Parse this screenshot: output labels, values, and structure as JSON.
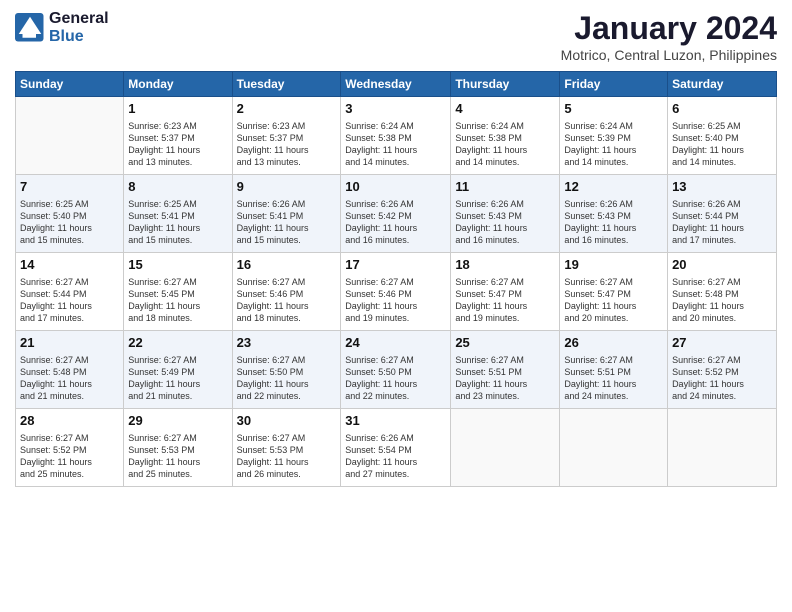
{
  "header": {
    "logo_line1": "General",
    "logo_line2": "Blue",
    "month_title": "January 2024",
    "location": "Motrico, Central Luzon, Philippines"
  },
  "weekdays": [
    "Sunday",
    "Monday",
    "Tuesday",
    "Wednesday",
    "Thursday",
    "Friday",
    "Saturday"
  ],
  "weeks": [
    [
      {
        "day": "",
        "info": ""
      },
      {
        "day": "1",
        "info": "Sunrise: 6:23 AM\nSunset: 5:37 PM\nDaylight: 11 hours\nand 13 minutes."
      },
      {
        "day": "2",
        "info": "Sunrise: 6:23 AM\nSunset: 5:37 PM\nDaylight: 11 hours\nand 13 minutes."
      },
      {
        "day": "3",
        "info": "Sunrise: 6:24 AM\nSunset: 5:38 PM\nDaylight: 11 hours\nand 14 minutes."
      },
      {
        "day": "4",
        "info": "Sunrise: 6:24 AM\nSunset: 5:38 PM\nDaylight: 11 hours\nand 14 minutes."
      },
      {
        "day": "5",
        "info": "Sunrise: 6:24 AM\nSunset: 5:39 PM\nDaylight: 11 hours\nand 14 minutes."
      },
      {
        "day": "6",
        "info": "Sunrise: 6:25 AM\nSunset: 5:40 PM\nDaylight: 11 hours\nand 14 minutes."
      }
    ],
    [
      {
        "day": "7",
        "info": "Sunrise: 6:25 AM\nSunset: 5:40 PM\nDaylight: 11 hours\nand 15 minutes."
      },
      {
        "day": "8",
        "info": "Sunrise: 6:25 AM\nSunset: 5:41 PM\nDaylight: 11 hours\nand 15 minutes."
      },
      {
        "day": "9",
        "info": "Sunrise: 6:26 AM\nSunset: 5:41 PM\nDaylight: 11 hours\nand 15 minutes."
      },
      {
        "day": "10",
        "info": "Sunrise: 6:26 AM\nSunset: 5:42 PM\nDaylight: 11 hours\nand 16 minutes."
      },
      {
        "day": "11",
        "info": "Sunrise: 6:26 AM\nSunset: 5:43 PM\nDaylight: 11 hours\nand 16 minutes."
      },
      {
        "day": "12",
        "info": "Sunrise: 6:26 AM\nSunset: 5:43 PM\nDaylight: 11 hours\nand 16 minutes."
      },
      {
        "day": "13",
        "info": "Sunrise: 6:26 AM\nSunset: 5:44 PM\nDaylight: 11 hours\nand 17 minutes."
      }
    ],
    [
      {
        "day": "14",
        "info": "Sunrise: 6:27 AM\nSunset: 5:44 PM\nDaylight: 11 hours\nand 17 minutes."
      },
      {
        "day": "15",
        "info": "Sunrise: 6:27 AM\nSunset: 5:45 PM\nDaylight: 11 hours\nand 18 minutes."
      },
      {
        "day": "16",
        "info": "Sunrise: 6:27 AM\nSunset: 5:46 PM\nDaylight: 11 hours\nand 18 minutes."
      },
      {
        "day": "17",
        "info": "Sunrise: 6:27 AM\nSunset: 5:46 PM\nDaylight: 11 hours\nand 19 minutes."
      },
      {
        "day": "18",
        "info": "Sunrise: 6:27 AM\nSunset: 5:47 PM\nDaylight: 11 hours\nand 19 minutes."
      },
      {
        "day": "19",
        "info": "Sunrise: 6:27 AM\nSunset: 5:47 PM\nDaylight: 11 hours\nand 20 minutes."
      },
      {
        "day": "20",
        "info": "Sunrise: 6:27 AM\nSunset: 5:48 PM\nDaylight: 11 hours\nand 20 minutes."
      }
    ],
    [
      {
        "day": "21",
        "info": "Sunrise: 6:27 AM\nSunset: 5:48 PM\nDaylight: 11 hours\nand 21 minutes."
      },
      {
        "day": "22",
        "info": "Sunrise: 6:27 AM\nSunset: 5:49 PM\nDaylight: 11 hours\nand 21 minutes."
      },
      {
        "day": "23",
        "info": "Sunrise: 6:27 AM\nSunset: 5:50 PM\nDaylight: 11 hours\nand 22 minutes."
      },
      {
        "day": "24",
        "info": "Sunrise: 6:27 AM\nSunset: 5:50 PM\nDaylight: 11 hours\nand 22 minutes."
      },
      {
        "day": "25",
        "info": "Sunrise: 6:27 AM\nSunset: 5:51 PM\nDaylight: 11 hours\nand 23 minutes."
      },
      {
        "day": "26",
        "info": "Sunrise: 6:27 AM\nSunset: 5:51 PM\nDaylight: 11 hours\nand 24 minutes."
      },
      {
        "day": "27",
        "info": "Sunrise: 6:27 AM\nSunset: 5:52 PM\nDaylight: 11 hours\nand 24 minutes."
      }
    ],
    [
      {
        "day": "28",
        "info": "Sunrise: 6:27 AM\nSunset: 5:52 PM\nDaylight: 11 hours\nand 25 minutes."
      },
      {
        "day": "29",
        "info": "Sunrise: 6:27 AM\nSunset: 5:53 PM\nDaylight: 11 hours\nand 25 minutes."
      },
      {
        "day": "30",
        "info": "Sunrise: 6:27 AM\nSunset: 5:53 PM\nDaylight: 11 hours\nand 26 minutes."
      },
      {
        "day": "31",
        "info": "Sunrise: 6:26 AM\nSunset: 5:54 PM\nDaylight: 11 hours\nand 27 minutes."
      },
      {
        "day": "",
        "info": ""
      },
      {
        "day": "",
        "info": ""
      },
      {
        "day": "",
        "info": ""
      }
    ]
  ]
}
